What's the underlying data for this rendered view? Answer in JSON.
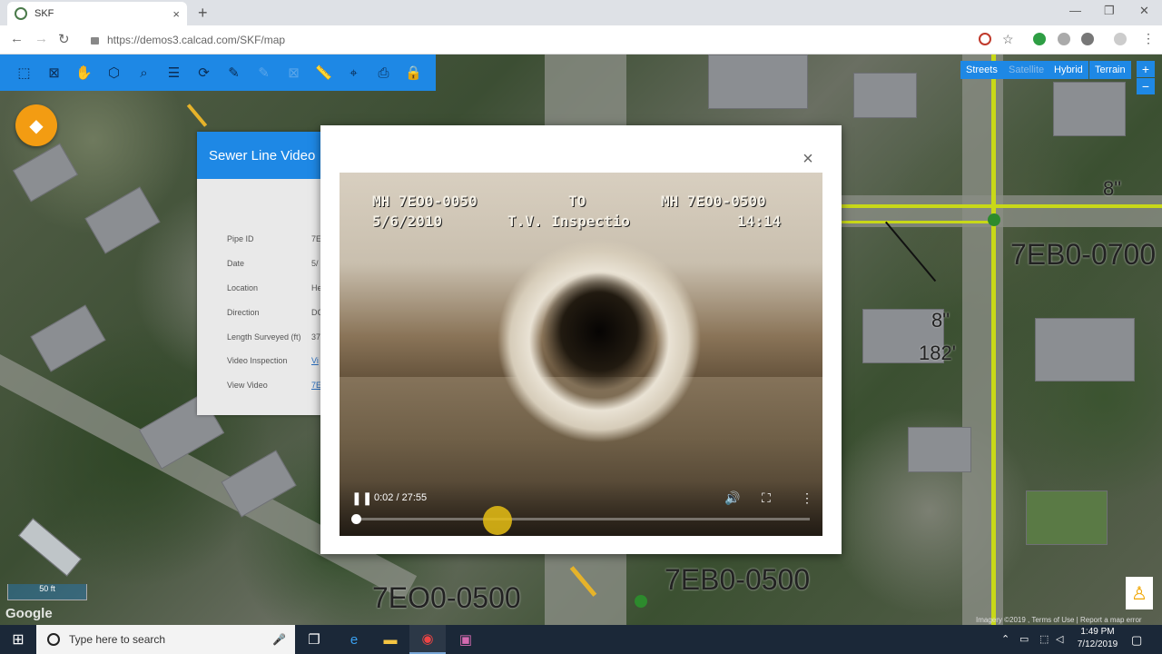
{
  "browser": {
    "tab_title": "SKF",
    "url": "https://demos3.calcad.com/SKF/map",
    "new_tab": "+",
    "close_tab": "×"
  },
  "map": {
    "type_buttons": [
      "Streets",
      "Satellite",
      "Hybrid",
      "Terrain"
    ],
    "zoom_in": "+",
    "zoom_out": "−",
    "labels": {
      "pipe_size_top": "8\"",
      "pipe_id_right": "7EB0-0700",
      "pipe_size_mid": "8\"",
      "pipe_length_mid": "182'",
      "pipe_id_bottom_left": "7EO0-0500",
      "pipe_id_bottom_right": "7EB0-0500"
    },
    "scale": "50 ft",
    "google": "Google",
    "terms": "Imagery ©2019 , Terms of Use | Report a map error"
  },
  "info_panel": {
    "title": "Sewer Line Video",
    "rows": [
      {
        "label": "Pipe ID",
        "value": "7E"
      },
      {
        "label": "Date",
        "value": "5/"
      },
      {
        "label": "Location",
        "value": "He"
      },
      {
        "label": "Direction",
        "value": "DC"
      },
      {
        "label": "Length Surveyed (ft)",
        "value": "37"
      },
      {
        "label": "Video Inspection",
        "value": "Vi"
      },
      {
        "label": "View Video",
        "value": "7E"
      }
    ]
  },
  "video": {
    "overlay_line1_left": "MH 7EO0-0050",
    "overlay_line1_mid": "TO",
    "overlay_line1_right": "MH 7EO0-0500",
    "overlay_line2_left": "5/6/2010",
    "overlay_line2_mid": "T.V. Inspectio",
    "overlay_line2_right": "14:14",
    "time": "0:02 / 27:55",
    "progress_fraction": 0.001,
    "close": "×"
  },
  "taskbar": {
    "search_placeholder": "Type here to search",
    "time": "1:49 PM",
    "date": "7/12/2019"
  }
}
